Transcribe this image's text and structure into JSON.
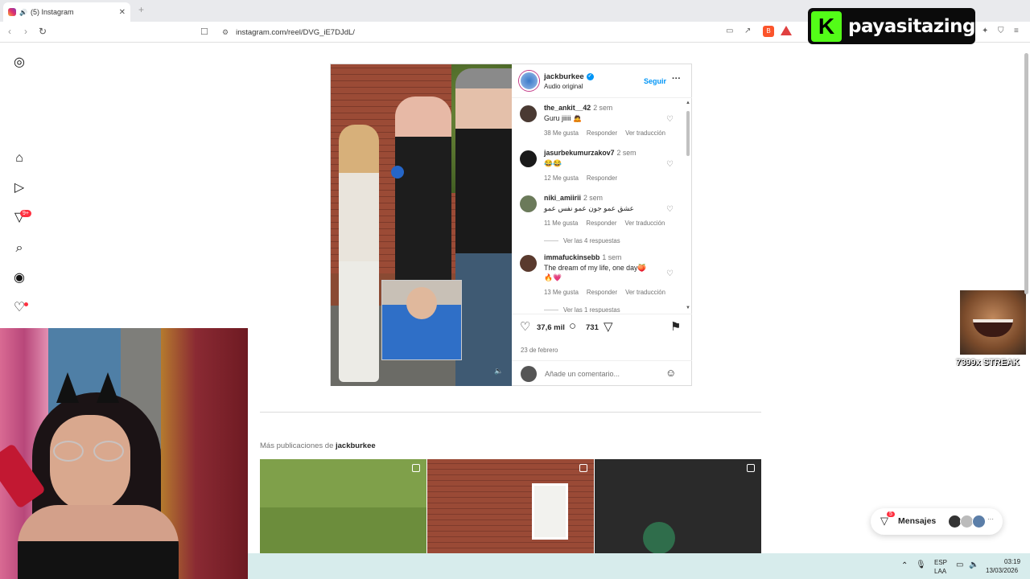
{
  "browser": {
    "tab_title": "(5) Instagram",
    "tab_sound_icon": "speaker-icon",
    "url": "instagram.com/reel/DVG_iE7DJdL/"
  },
  "overlay": {
    "channel_name": "payasitazing",
    "streak_text": "7399x STREAK"
  },
  "sidebar": {
    "notifications_badge": "9+"
  },
  "post": {
    "username": "jackburkee",
    "audio": "Audio original",
    "follow_label": "Seguir",
    "likes": "37,6 mil",
    "comments_count": "731",
    "date": "23 de febrero",
    "add_comment_placeholder": "Añade un comentario...",
    "comments": [
      {
        "user": "the_ankit__42",
        "time": "2 sem",
        "text": "Guru jiiiii 🙇",
        "likes": "38 Me gusta",
        "reply": "Responder",
        "translate": "Ver traducción"
      },
      {
        "user": "jasurbekumurzakov7",
        "time": "2 sem",
        "text": "😂😂",
        "likes": "12 Me gusta",
        "reply": "Responder"
      },
      {
        "user": "niki_amiirii",
        "time": "2 sem",
        "text": "عشق عمو جون عمو نفس عمو",
        "likes": "11 Me gusta",
        "reply": "Responder",
        "translate": "Ver traducción",
        "replies": "Ver las 4 respuestas"
      },
      {
        "user": "immafuckinsebb",
        "time": "1 sem",
        "text": "The dream of my life, one day🍑",
        "text2": "🔥💗",
        "likes": "13 Me gusta",
        "reply": "Responder",
        "translate": "Ver traducción",
        "replies": "Ver las 1 respuestas"
      }
    ]
  },
  "more_posts": {
    "prefix": "Más publicaciones de",
    "user": "jackburkee"
  },
  "messages": {
    "label": "Mensajes",
    "badge": "5"
  },
  "taskbar": {
    "lang1": "ESP",
    "lang2": "LAA",
    "time": "03:19",
    "date": "13/03/2026"
  },
  "colors": {
    "instagram_blue": "#0095f6",
    "notification_red": "#ff3040",
    "kick_green": "#53fc18"
  }
}
